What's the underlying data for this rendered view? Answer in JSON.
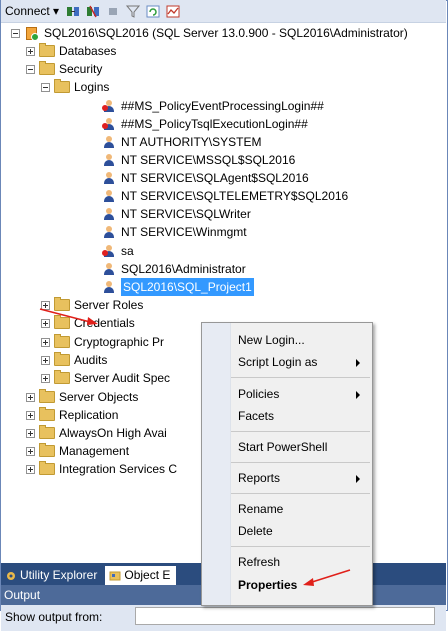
{
  "toolbar": {
    "connect_label": "Connect ▾"
  },
  "tree": {
    "server_label": "SQL2016\\SQL2016 (SQL Server 13.0.900 - SQL2016\\Administrator)",
    "databases": "Databases",
    "security": "Security",
    "logins": "Logins",
    "login_items": [
      "##MS_PolicyEventProcessingLogin##",
      "##MS_PolicyTsqlExecutionLogin##",
      "NT AUTHORITY\\SYSTEM",
      "NT SERVICE\\MSSQL$SQL2016",
      "NT SERVICE\\SQLAgent$SQL2016",
      "NT SERVICE\\SQLTELEMETRY$SQL2016",
      "NT SERVICE\\SQLWriter",
      "NT SERVICE\\Winmgmt",
      "sa",
      "SQL2016\\Administrator",
      "SQL2016\\SQL_Project1"
    ],
    "security_children": [
      "Server Roles",
      "Credentials",
      "Cryptographic Pr",
      "Audits",
      "Server Audit Spec"
    ],
    "server_children": [
      "Server Objects",
      "Replication",
      "AlwaysOn High Avai",
      "Management",
      "Integration Services C"
    ]
  },
  "tabs": {
    "utility_explorer": "Utility Explorer",
    "object_explorer": "Object E"
  },
  "output": {
    "title": "Output",
    "show_from_label": "Show output from:"
  },
  "context_menu": {
    "items": [
      "New Login...",
      "Script Login as",
      "Policies",
      "Facets",
      "Start PowerShell",
      "Reports",
      "Rename",
      "Delete",
      "Refresh",
      "Properties"
    ]
  }
}
